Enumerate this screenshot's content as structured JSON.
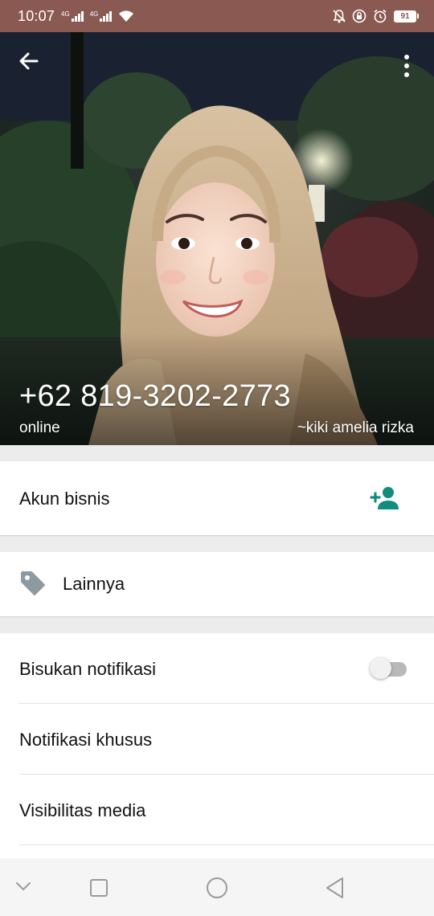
{
  "status_bar": {
    "time": "10:07",
    "signal_1_label": "4G",
    "signal_2_label": "4G",
    "battery": "91",
    "icons": [
      "wifi-icon",
      "mute-bell-icon",
      "lock-rotation-icon",
      "alarm-icon",
      "battery-icon"
    ]
  },
  "profile": {
    "phone": "+62 819-3202-2773",
    "status": "online",
    "push_name": "~kiki amelia rizka"
  },
  "business": {
    "label": "Akun bisnis"
  },
  "other": {
    "label": "Lainnya"
  },
  "settings": {
    "mute_label": "Bisukan notifikasi",
    "mute_enabled": false,
    "custom_notif_label": "Notifikasi khusus",
    "media_visibility_label": "Visibilitas media"
  },
  "colors": {
    "status_bar": "#8a5a52",
    "accent": "#128c7e",
    "tag_icon": "#8e9aa2"
  }
}
